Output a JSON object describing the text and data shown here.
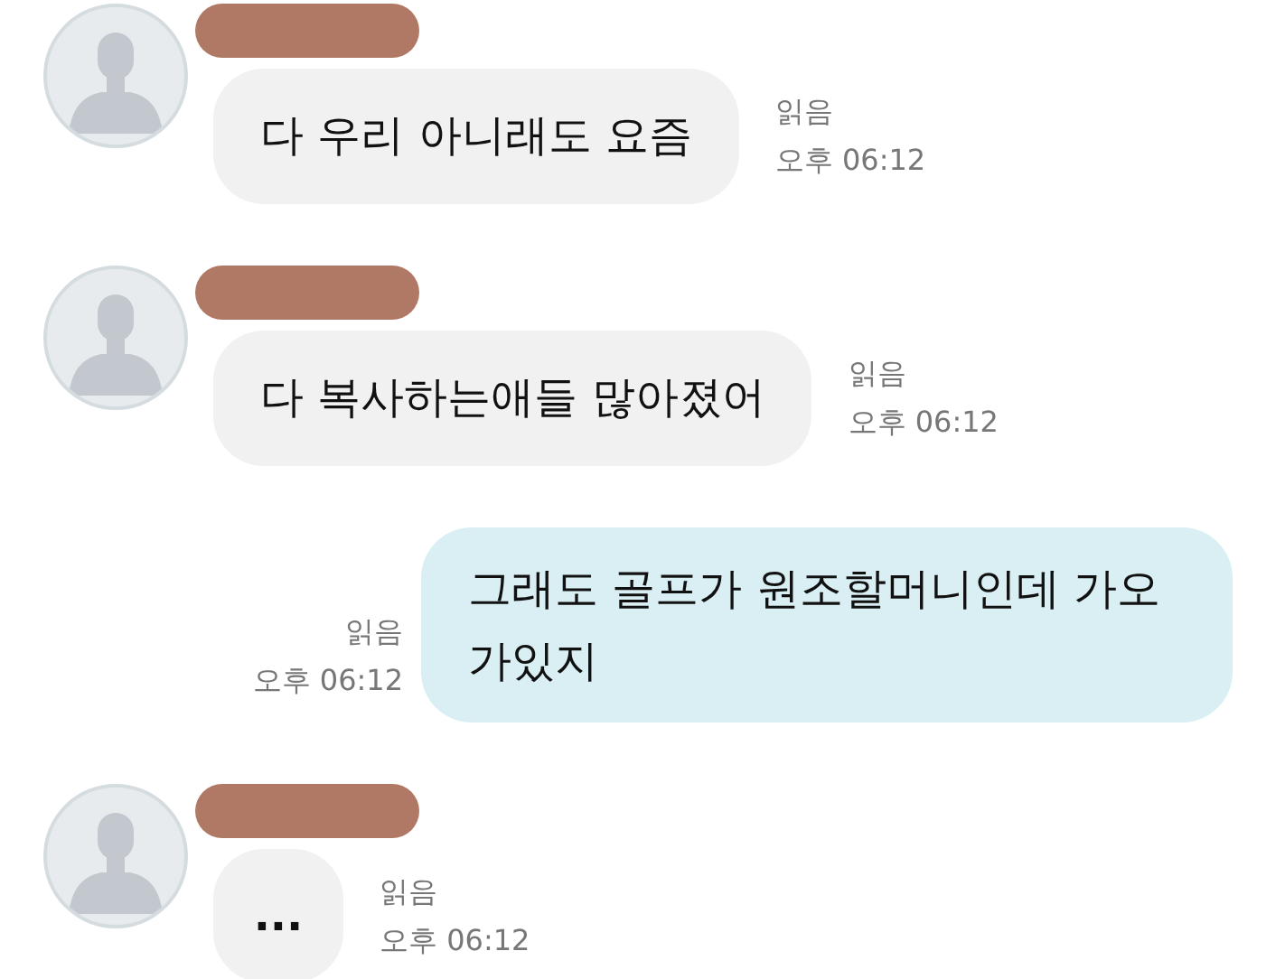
{
  "messages": [
    {
      "kind": "incoming",
      "text": "다 우리 아니래도 요즘",
      "read": "읽음",
      "time": "오후 06:12"
    },
    {
      "kind": "incoming",
      "text": "다 복사하는애들 많아졌어",
      "read": "읽음",
      "time": "오후 06:12"
    },
    {
      "kind": "outgoing",
      "text": "그래도 골프가 원조할머니인데 가오가있지",
      "read": "읽음",
      "time": "오후 06:12"
    },
    {
      "kind": "incoming",
      "text": "...",
      "read": "읽음",
      "time": "오후 06:12"
    }
  ]
}
